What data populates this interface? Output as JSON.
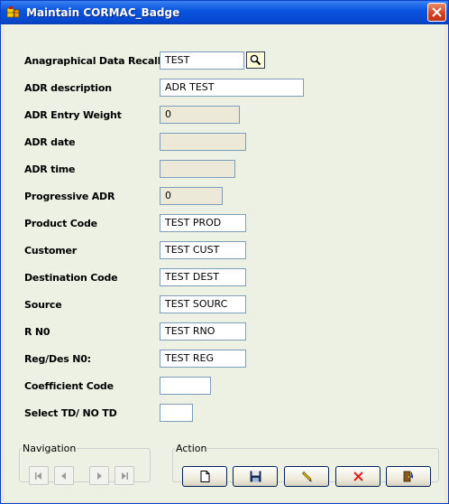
{
  "window": {
    "title": "Maintain CORMAC_Badge"
  },
  "form": {
    "fields": [
      {
        "label": "Anagraphical Data Recall",
        "value": "TEST"
      },
      {
        "label": "ADR description",
        "value": "ADR TEST"
      },
      {
        "label": "ADR Entry Weight",
        "value": "0"
      },
      {
        "label": "ADR date",
        "value": ""
      },
      {
        "label": "ADR time",
        "value": ""
      },
      {
        "label": "Progressive ADR",
        "value": "0"
      },
      {
        "label": "Product Code",
        "value": "TEST PROD"
      },
      {
        "label": "Customer",
        "value": "TEST CUST"
      },
      {
        "label": "Destination Code",
        "value": "TEST DEST"
      },
      {
        "label": "Source",
        "value": "TEST SOURC"
      },
      {
        "label": "R N0",
        "value": "TEST RNO"
      },
      {
        "label": "Reg/Des N0:",
        "value": "TEST REG"
      },
      {
        "label": "Coefficient Code",
        "value": ""
      },
      {
        "label": "Select TD/ NO TD",
        "value": ""
      }
    ]
  },
  "navigation": {
    "legend": "Navigation",
    "buttons": [
      "first-record-icon",
      "previous-record-icon",
      "next-record-icon",
      "last-record-icon"
    ]
  },
  "action": {
    "legend": "Action",
    "buttons": [
      "new-document-icon",
      "save-disk-icon",
      "edit-pencil-icon",
      "delete-x-icon",
      "exit-door-icon"
    ]
  },
  "colors": {
    "titlebar": "#0a55e0",
    "close_button": "#d0401b",
    "form_background": "#ecf1e4",
    "field_border": "#7f9db9",
    "delete_icon": "#e02020"
  }
}
